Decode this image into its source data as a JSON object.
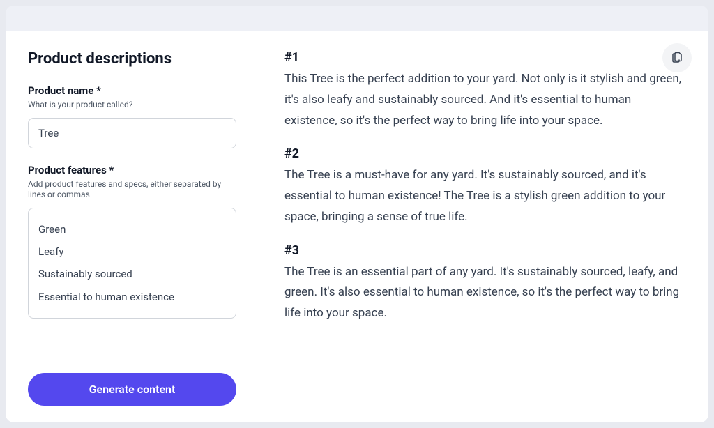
{
  "page_title": "Product descriptions",
  "form": {
    "product_name": {
      "label": "Product name *",
      "hint": "What is your product called?",
      "value": "Tree"
    },
    "product_features": {
      "label": "Product features *",
      "hint": "Add product features and specs, either separated by lines or commas",
      "value": "Green\nLeafy\nSustainably sourced\nEssential to human existence"
    },
    "generate_button_label": "Generate content"
  },
  "outputs": [
    {
      "heading": "#1",
      "text": "This Tree is the perfect addition to your yard. Not only is it stylish and green, it's also leafy and sustainably sourced. And it's essential to human existence, so it's the perfect way to bring life into your space."
    },
    {
      "heading": "#2",
      "text": "The Tree is a must-have for any yard. It's sustainably sourced, and it's essential to human existence! The Tree is a stylish green addition to your space, bringing a sense of true life."
    },
    {
      "heading": "#3",
      "text": "The Tree is an essential part of any yard. It's sustainably sourced, leafy, and green. It's also essential to human existence, so it's the perfect way to bring life into your space."
    }
  ]
}
